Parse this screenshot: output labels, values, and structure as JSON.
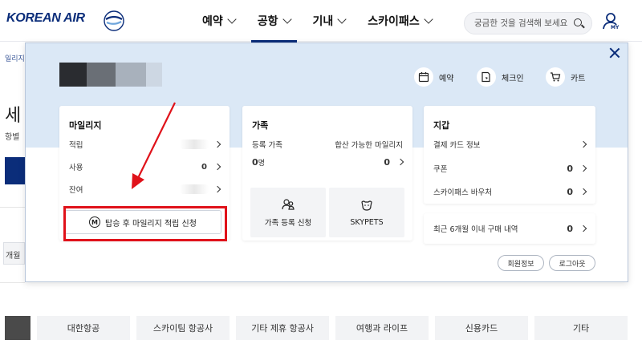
{
  "header": {
    "logo_text": "KOREAN AIR",
    "nav": [
      {
        "label": "예약",
        "active": false
      },
      {
        "label": "공항",
        "active": true
      },
      {
        "label": "기내",
        "active": false
      },
      {
        "label": "스카이패스",
        "active": false
      }
    ],
    "search_placeholder": "궁금한 것을 검색해 보세요",
    "my_label": "MY"
  },
  "background": {
    "breadcrumb_frag": "일리지",
    "title_frag": "세",
    "subtitle_frag": "항별",
    "select_frag": "개월"
  },
  "panel": {
    "quick_links": [
      {
        "label": "예약",
        "icon": "calendar-icon"
      },
      {
        "label": "체크인",
        "icon": "checkin-icon"
      },
      {
        "label": "카트",
        "icon": "cart-icon"
      }
    ],
    "mileage": {
      "title": "마일리지",
      "rows": [
        {
          "label": "적립",
          "value": ""
        },
        {
          "label": "사용",
          "value": "0"
        },
        {
          "label": "잔여",
          "value": ""
        }
      ],
      "accrual_button": "탑승 후 마일리지 적립 신청",
      "m_icon_letter": "M"
    },
    "family": {
      "title": "가족",
      "registered_label": "등록 가족",
      "combinable_label": "합산 가능한 마일리지",
      "registered_value": "0",
      "registered_unit": "명",
      "combinable_value": "0",
      "tiles": [
        {
          "label": "가족 등록 신청",
          "icon": "family-icon"
        },
        {
          "label": "SKYPETS",
          "icon": "pet-icon"
        }
      ]
    },
    "wallet": {
      "title": "지갑",
      "rows": [
        {
          "label": "결제 카드 정보",
          "value": ""
        },
        {
          "label": "쿠폰",
          "value": "0"
        },
        {
          "label": "스카이패스 바우처",
          "value": "0"
        }
      ],
      "recent_purchases_label": "최근 6개월 이내 구매 내역",
      "recent_purchases_value": "0"
    },
    "buttons": {
      "member_info": "회원정보",
      "logout": "로그아웃"
    }
  },
  "category_tabs": [
    "대한항공",
    "스카이팀 항공사",
    "기타 제휴 항공사",
    "여행과 라이프",
    "신용카드",
    "기타"
  ],
  "colors": {
    "brand_navy": "#0b2d7a",
    "panel_top_bg": "#dbe8f6",
    "highlight_red": "#e0121a"
  }
}
